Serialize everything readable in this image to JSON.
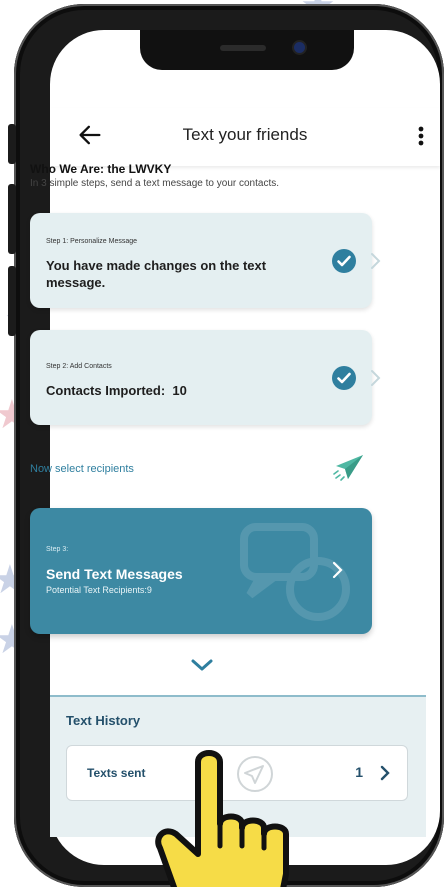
{
  "header": {
    "title": "Text your friends"
  },
  "intro": {
    "title": "Who We Are: the LWVKY",
    "subtitle": "In 3 simple steps, send a text message to your contacts."
  },
  "steps": [
    {
      "label": "Step 1: Personalize Message",
      "main": "You have made changes on the text message.",
      "completed": true
    },
    {
      "label": "Step 2: Add Contacts",
      "main": "Contacts Imported:  10",
      "completed": true
    },
    {
      "label": "Step 3:",
      "main": "Send Text Messages",
      "sub": "Potential Text Recipients:9"
    }
  ],
  "now_select": "Now select recipients",
  "history": {
    "title": "Text History",
    "row_label": "Texts sent",
    "row_count": "1"
  },
  "colors": {
    "accent": "#2f7f9f",
    "step3_card": "#3d89a3",
    "card_bg": "#e4eff1",
    "plane": "#4fb8a3",
    "hand": "#f6dc47"
  },
  "icons": [
    "back-arrow-icon",
    "more-vert-icon",
    "check-circle-icon",
    "chevron-right-icon",
    "paper-plane-icon",
    "chat-bubble-icon",
    "chevron-down-icon",
    "send-circle-icon",
    "pointing-hand-icon"
  ]
}
